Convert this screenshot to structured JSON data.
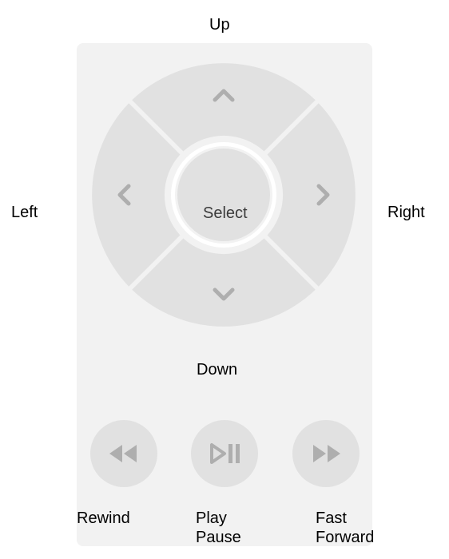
{
  "labels": {
    "up": "Up",
    "down": "Down",
    "left": "Left",
    "right": "Right",
    "select": "Select",
    "rewind": "Rewind",
    "play_line1": "Play",
    "play_line2": "Pause",
    "fast_line1": "Fast",
    "fast_line2": "Forward"
  }
}
